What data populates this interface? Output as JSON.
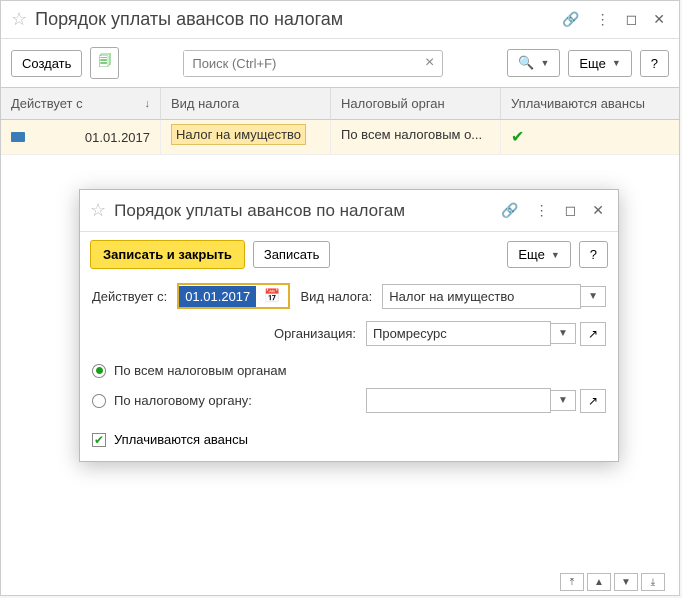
{
  "main": {
    "title": "Порядок уплаты авансов по налогам",
    "create_label": "Создать",
    "search_placeholder": "Поиск (Ctrl+F)",
    "more_label": "Еще",
    "help_label": "?",
    "columns": {
      "col1": "Действует с",
      "col2": "Вид налога",
      "col3": "Налоговый орган",
      "col4": "Уплачиваются авансы"
    },
    "row": {
      "date": "01.01.2017",
      "tax": "Налог на имущество",
      "authority": "По всем налоговым о..."
    }
  },
  "modal": {
    "title": "Порядок уплаты авансов по налогам",
    "save_close": "Записать и закрыть",
    "save": "Записать",
    "more": "Еще",
    "help": "?",
    "date_label": "Действует с:",
    "date_value": "01.01.2017",
    "tax_label": "Вид налога:",
    "tax_value": "Налог на имущество",
    "org_label": "Организация:",
    "org_value": "Промресурс",
    "radio_all": "По всем налоговым органам",
    "radio_one": "По налоговому органу:",
    "check_label": "Уплачиваются авансы"
  }
}
